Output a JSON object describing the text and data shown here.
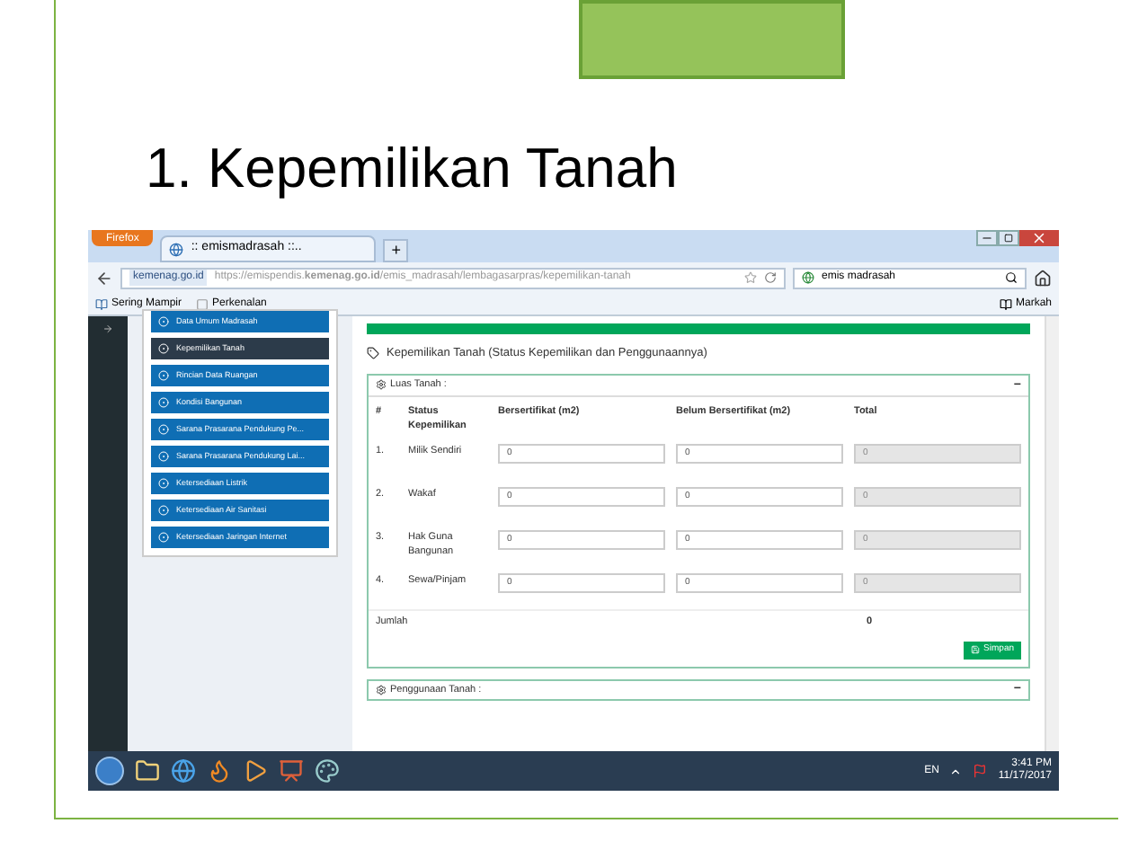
{
  "slide": {
    "title": "1. Kepemilikan Tanah"
  },
  "browser": {
    "menu_button": "Firefox",
    "tab": ":: emismadrasah ::..",
    "new_tab": "+",
    "site": "kemenag.go.id",
    "url": "https://emispendis.**kemenag.go.id**/emis_madrasah/lembagasarpras/kepemilikan-tanah",
    "search": "emis madrasah",
    "bookmarks": [
      "Sering Mampir",
      "Perkenalan"
    ],
    "bookmarks_menu": "Markah"
  },
  "sidebar": {
    "items": [
      {
        "label": "Data Umum Madrasah",
        "selected": false
      },
      {
        "label": "Kepemilikan Tanah",
        "selected": true
      },
      {
        "label": "Rincian Data Ruangan",
        "selected": false
      },
      {
        "label": "Kondisi Bangunan",
        "selected": false
      },
      {
        "label": "Sarana Prasarana Pendukung Pe...",
        "selected": false
      },
      {
        "label": "Sarana Prasarana Pendukung Lai...",
        "selected": false
      },
      {
        "label": "Ketersediaan Listrik",
        "selected": false
      },
      {
        "label": "Ketersediaan Air Sanitasi",
        "selected": false
      },
      {
        "label": "Ketersediaan Jaringan Internet",
        "selected": false
      }
    ]
  },
  "page": {
    "heading": "Kepemilikan Tanah (Status Kepemilikan dan Penggunaannya)",
    "panel": {
      "title": "Luas Tanah :",
      "collapse": "−",
      "columns": [
        "#",
        "Status Kepemilikan",
        "Bersertifikat (m2)",
        "Belum Bersertifikat (m2)",
        "Total"
      ],
      "rows": [
        {
          "no": "1.",
          "status": "Milik Sendiri",
          "certified": "0",
          "uncertified": "0",
          "total": "0"
        },
        {
          "no": "2.",
          "status": "Wakaf",
          "certified": "0",
          "uncertified": "0",
          "total": "0"
        },
        {
          "no": "3.",
          "status": "Hak Guna Bangunan",
          "certified": "0",
          "uncertified": "0",
          "total": "0"
        },
        {
          "no": "4.",
          "status": "Sewa/Pinjam",
          "certified": "0",
          "uncertified": "0",
          "total": "0"
        }
      ],
      "total_label": "Jumlah",
      "total_value": "0",
      "save": "Simpan"
    },
    "panel2": {
      "title": "Penggunaan Tanah :",
      "collapse": "−"
    }
  },
  "taskbar": {
    "language": "EN",
    "time": "3:41 PM",
    "date": "11/17/2017"
  }
}
